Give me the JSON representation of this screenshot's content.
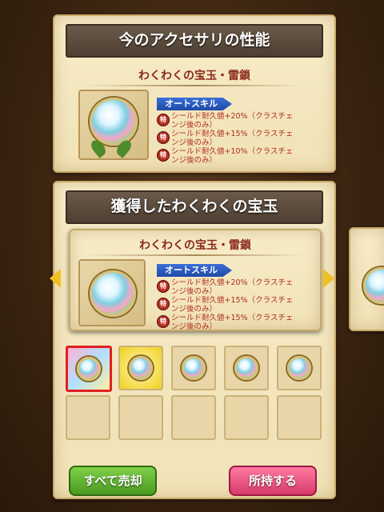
{
  "current_panel": {
    "title": "今のアクセサリの性能",
    "item_name": "わくわくの宝玉・雷鎖",
    "skill_type": "オートスキル",
    "skills": [
      {
        "badge": "特",
        "text1": "シールド耐久値+20%（クラスチェ",
        "text2": "ンジ後のみ）"
      },
      {
        "badge": "特",
        "text1": "シールド耐久値+15%（クラスチェ",
        "text2": "ンジ後のみ）"
      },
      {
        "badge": "特",
        "text1": "シールド耐久値+10%（クラスチェ",
        "text2": "ンジ後のみ）"
      }
    ]
  },
  "acquired_panel": {
    "title": "獲得したわくわくの宝玉",
    "item_name": "わくわくの宝玉・雷鎖",
    "skill_type": "オートスキル",
    "skills": [
      {
        "badge": "特",
        "text1": "シールド耐久値+20%（クラスチェ",
        "text2": "ンジ後のみ）"
      },
      {
        "badge": "特",
        "text1": "シールド耐久値+15%（クラスチェ",
        "text2": "ンジ後のみ）"
      },
      {
        "badge": "特",
        "text1": "シールド耐久値+15%（クラスチェ",
        "text2": "ンジ後のみ）"
      }
    ]
  },
  "buttons": {
    "sell_all": "すべて売却",
    "keep": "所持する"
  },
  "colors": {
    "sell_button": "#5fae2e",
    "keep_button": "#e8507a",
    "selected_slot_border": "#e02020"
  }
}
